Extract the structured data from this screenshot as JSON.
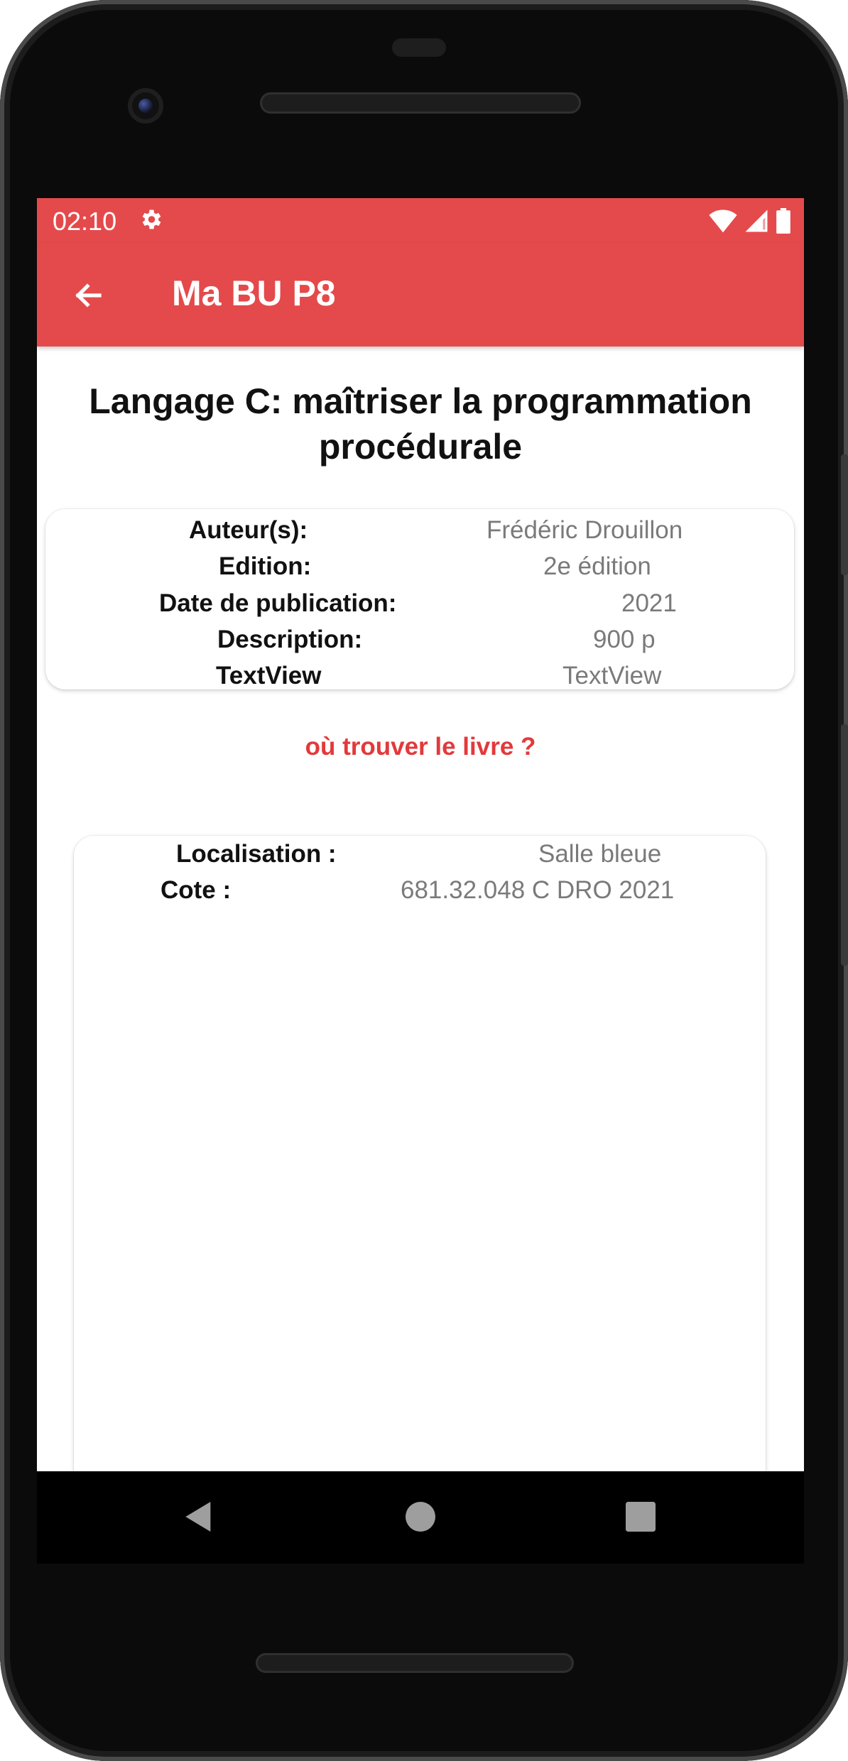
{
  "status_bar": {
    "time": "02:10",
    "icons": [
      "settings-icon",
      "wifi-icon",
      "signal-icon",
      "battery-icon"
    ]
  },
  "app_bar": {
    "title": "Ma BU P8",
    "nav_icon": "back-arrow-icon"
  },
  "book": {
    "title": "Langage C: maîtriser la programmation procédurale"
  },
  "details": [
    {
      "label": "Auteur(s):",
      "value": "Frédéric Drouillon"
    },
    {
      "label": "Edition:",
      "value": "2e édition"
    },
    {
      "label": "Date de publication:",
      "value": "2021"
    },
    {
      "label": "Description:",
      "value": "900 p"
    },
    {
      "label": "TextView",
      "value": "TextView"
    }
  ],
  "location_link": "où trouver le livre ?",
  "location": [
    {
      "label": "Localisation :",
      "value": "Salle bleue"
    },
    {
      "label": "Cote :",
      "value": "681.32.048 C DRO 2021"
    }
  ],
  "navigation": [
    "back-triangle-icon",
    "home-circle-icon",
    "recents-square-icon"
  ],
  "colors": {
    "accent": "#e44a4b",
    "link": "#e3393b",
    "value_text": "#7a7a7a"
  }
}
